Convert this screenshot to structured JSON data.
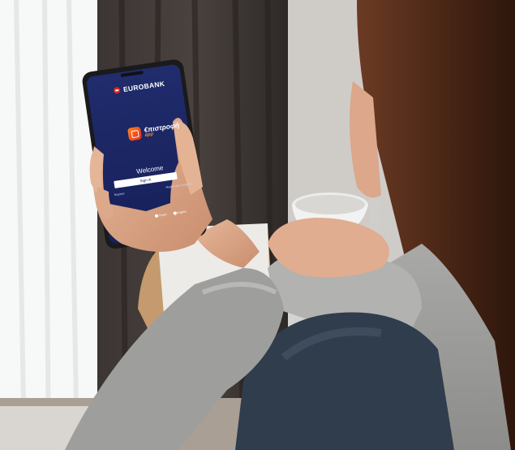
{
  "phone_screen": {
    "brand": "EUROBANK",
    "app_title": "€πιστροφή",
    "app_subtitle": "app",
    "welcome": "Welcome",
    "signin_button": "Sign in",
    "register_link": "Register",
    "forgot_link": "Registration forgotten",
    "lang_greek": "Greek",
    "lang_english": "English"
  },
  "colors": {
    "screen_bg": "#1b2660",
    "brand_red": "#e2261d",
    "accent_orange": "#ff8a1f"
  }
}
